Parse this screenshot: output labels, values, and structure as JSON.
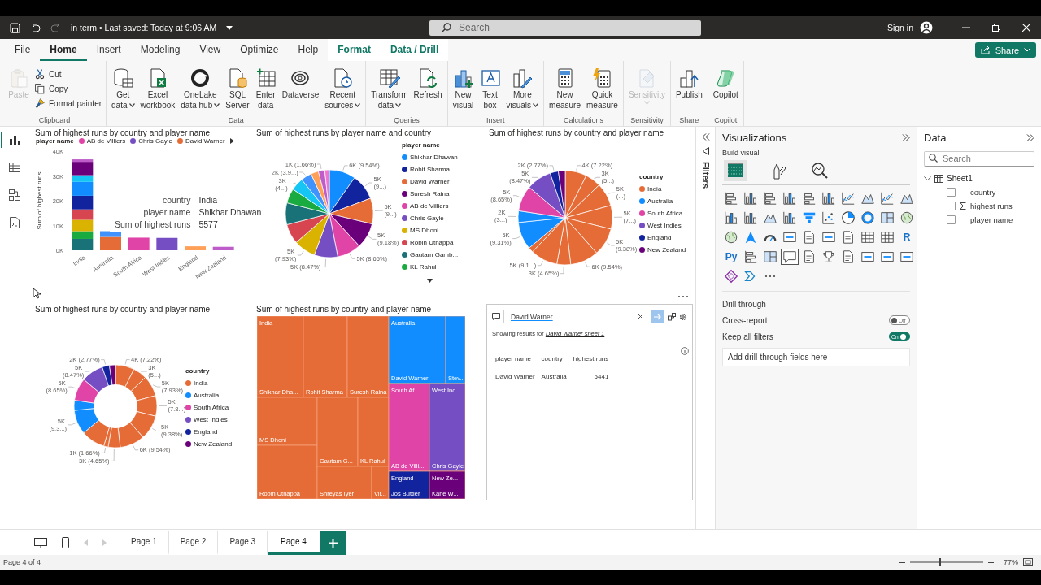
{
  "title_bar": {
    "document": "in term • Last saved: Today at 9:06 AM",
    "search_placeholder": "Search",
    "sign_in": "Sign in"
  },
  "ribbon_tabs": [
    {
      "label": "File",
      "selected": false,
      "kind": "normal"
    },
    {
      "label": "Home",
      "selected": true,
      "kind": "normal"
    },
    {
      "label": "Insert",
      "selected": false,
      "kind": "normal"
    },
    {
      "label": "Modeling",
      "selected": false,
      "kind": "normal"
    },
    {
      "label": "View",
      "selected": false,
      "kind": "normal"
    },
    {
      "label": "Optimize",
      "selected": false,
      "kind": "normal"
    },
    {
      "label": "Help",
      "selected": false,
      "kind": "normal"
    },
    {
      "label": "Format",
      "selected": false,
      "kind": "contextual"
    },
    {
      "label": "Data / Drill",
      "selected": false,
      "kind": "contextual"
    }
  ],
  "share_button": "Share",
  "ribbon_groups": [
    {
      "name": "Clipboard",
      "buttons": [
        {
          "kind": "large",
          "lines": [
            "Paste"
          ],
          "disabled": true,
          "dropdown": false
        },
        {
          "kind": "small",
          "lines": [
            "Cut"
          ],
          "disabled": false,
          "dropdown": false
        },
        {
          "kind": "small",
          "lines": [
            "Copy"
          ],
          "disabled": false,
          "dropdown": false
        },
        {
          "kind": "small",
          "lines": [
            "Format painter"
          ],
          "disabled": false,
          "dropdown": false
        }
      ]
    },
    {
      "name": "Data",
      "buttons": [
        {
          "kind": "large",
          "lines": [
            "Get",
            "data"
          ],
          "disabled": false,
          "dropdown": true
        },
        {
          "kind": "large",
          "lines": [
            "Excel",
            "workbook"
          ],
          "disabled": false,
          "dropdown": false
        },
        {
          "kind": "large",
          "lines": [
            "OneLake",
            "data hub"
          ],
          "disabled": false,
          "dropdown": true
        },
        {
          "kind": "large",
          "lines": [
            "SQL",
            "Server"
          ],
          "disabled": false,
          "dropdown": false
        },
        {
          "kind": "large",
          "lines": [
            "Enter",
            "data"
          ],
          "disabled": false,
          "dropdown": false
        },
        {
          "kind": "large",
          "lines": [
            "Dataverse"
          ],
          "disabled": false,
          "dropdown": false
        },
        {
          "kind": "large",
          "lines": [
            "Recent",
            "sources"
          ],
          "disabled": false,
          "dropdown": true
        }
      ]
    },
    {
      "name": "Queries",
      "buttons": [
        {
          "kind": "large",
          "lines": [
            "Transform",
            "data"
          ],
          "disabled": false,
          "dropdown": true
        },
        {
          "kind": "large",
          "lines": [
            "Refresh"
          ],
          "disabled": false,
          "dropdown": false
        }
      ]
    },
    {
      "name": "Insert",
      "buttons": [
        {
          "kind": "large",
          "lines": [
            "New",
            "visual"
          ],
          "disabled": false,
          "dropdown": false
        },
        {
          "kind": "large",
          "lines": [
            "Text",
            "box"
          ],
          "disabled": false,
          "dropdown": false
        },
        {
          "kind": "large",
          "lines": [
            "More",
            "visuals"
          ],
          "disabled": false,
          "dropdown": true
        }
      ]
    },
    {
      "name": "Calculations",
      "buttons": [
        {
          "kind": "large",
          "lines": [
            "New",
            "measure"
          ],
          "disabled": false,
          "dropdown": false
        },
        {
          "kind": "large",
          "lines": [
            "Quick",
            "measure"
          ],
          "disabled": false,
          "dropdown": false
        }
      ]
    },
    {
      "name": "Sensitivity",
      "buttons": [
        {
          "kind": "large",
          "lines": [
            "Sensitivity"
          ],
          "disabled": true,
          "dropdown": true
        }
      ]
    },
    {
      "name": "Share",
      "buttons": [
        {
          "kind": "large",
          "lines": [
            "Publish"
          ],
          "disabled": false,
          "dropdown": false
        }
      ]
    },
    {
      "name": "Copilot",
      "buttons": [
        {
          "kind": "large",
          "lines": [
            "Copilot"
          ],
          "disabled": false,
          "dropdown": false
        }
      ]
    }
  ],
  "left_rail": [
    {
      "selected": true
    },
    {
      "selected": false
    },
    {
      "selected": false
    },
    {
      "selected": false
    }
  ],
  "visuals": [
    {
      "kind": "bar",
      "title": "Sum of highest runs by country and player name",
      "legend_title": "player name",
      "legend": [
        {
          "label": "AB de Villiers",
          "color": "#e044a7"
        },
        {
          "label": "Chris Gayle",
          "color": "#744ec2"
        },
        {
          "label": "David Warner",
          "color": "#e66c37"
        }
      ],
      "tooltip": [
        {
          "key": "country",
          "value": "India"
        },
        {
          "key": "player name",
          "value": "Shikhar Dhawan"
        },
        {
          "key": "Sum of highest runs",
          "value": "5577"
        }
      ],
      "chart_data": {
        "type": "bar",
        "stacked": true,
        "orientation": "vertical",
        "ylabel": "Sum of highest runs",
        "categories": [
          "India",
          "Australia",
          "South Africa",
          "West Indies",
          "England",
          "New Zealand"
        ],
        "ylim": [
          0,
          40000
        ],
        "yticks": [
          {
            "value": 0,
            "label": "0K"
          },
          {
            "value": 10000,
            "label": "10K"
          },
          {
            "value": 20000,
            "label": "20K"
          },
          {
            "value": 30000,
            "label": "30K"
          },
          {
            "value": 40000,
            "label": "40K"
          }
        ],
        "series": [
          {
            "color": "#197278",
            "values": [
              4600,
              null,
              null,
              null,
              null,
              null
            ]
          },
          {
            "color": "#1aab40",
            "values": [
              3100,
              null,
              null,
              null,
              null,
              null
            ]
          },
          {
            "color": "#d9b300",
            "values": [
              4600,
              null,
              null,
              null,
              null,
              null
            ]
          },
          {
            "color": "#d64550",
            "values": [
              4200,
              null,
              null,
              null,
              null,
              null
            ]
          },
          {
            "color": "#12239e",
            "values": [
              5500,
              null,
              null,
              null,
              null,
              null
            ]
          },
          {
            "color": "#118dff",
            "values": [
              5600,
              null,
              null,
              null,
              null,
              null
            ]
          },
          {
            "color": "#15c6f4",
            "values": [
              2700,
              null,
              null,
              null,
              null,
              null
            ]
          },
          {
            "color": "#6b007b",
            "values": [
              5400,
              null,
              null,
              null,
              null,
              null
            ]
          },
          {
            "color": "#be5dc9",
            "values": [
              1000,
              null,
              null,
              null,
              null,
              null
            ]
          },
          {
            "color": "#e66c37",
            "values": [
              null,
              5400,
              null,
              null,
              null,
              null
            ]
          },
          {
            "color": "#4092ff",
            "values": [
              null,
              2300,
              null,
              null,
              null,
              null
            ]
          },
          {
            "color": "#e044a7",
            "values": [
              null,
              null,
              5100,
              null,
              null,
              null
            ]
          },
          {
            "color": "#744ec2",
            "values": [
              null,
              null,
              null,
              5000,
              null,
              null
            ]
          },
          {
            "color": "#ffa058",
            "values": [
              null,
              null,
              null,
              null,
              1600,
              null
            ]
          },
          {
            "color": "#be5dc9",
            "values": [
              null,
              null,
              null,
              null,
              null,
              1400
            ]
          }
        ]
      }
    },
    {
      "kind": "pie",
      "title": "Sum of highest runs by player name and country",
      "legend_title": "player name",
      "legend_more": true,
      "legend": [
        {
          "label": "Shikhar Dhawan",
          "color": "#118dff"
        },
        {
          "label": "Rohit Sharma",
          "color": "#12239e"
        },
        {
          "label": "David Warner",
          "color": "#e66c37"
        },
        {
          "label": "Suresh Raina",
          "color": "#6b007b"
        },
        {
          "label": "AB de Villiers",
          "color": "#e044a7"
        },
        {
          "label": "Chris Gayle",
          "color": "#744ec2"
        },
        {
          "label": "MS Dhoni",
          "color": "#d9b300"
        },
        {
          "label": "Robin Uthappa",
          "color": "#d64550"
        },
        {
          "label": "Gautam Gamb...",
          "color": "#197278"
        },
        {
          "label": "KL Rahul",
          "color": "#1aab40"
        }
      ],
      "chart_data": {
        "type": "pie",
        "values": [
          5577,
          5484,
          5441,
          5368,
          5057,
          4952,
          4636,
          4221,
          4600,
          3100,
          2718,
          2280,
          1619,
          1350,
          970
        ],
        "colors": [
          "#118dff",
          "#12239e",
          "#e66c37",
          "#6b007b",
          "#e044a7",
          "#744ec2",
          "#d9b300",
          "#d64550",
          "#197278",
          "#1aab40",
          "#15c6f4",
          "#4092ff",
          "#ffa058",
          "#be5dc9",
          "#f472d0"
        ],
        "value_labels": [
          "6K (9.54%)",
          "5K (9...)",
          "5K (9...)",
          "5K (9.18%)",
          "5K (8.65%)",
          "5K (8.47%)",
          "5K (7.93%)",
          null,
          null,
          null,
          "3K (4...)",
          "2K (3.9...)",
          null,
          "1K (1.66%)",
          null
        ]
      }
    },
    {
      "kind": "pie",
      "title": "Sum of highest runs by country and player name",
      "legend_title": "country",
      "legend_more": false,
      "legend": [
        {
          "label": "India",
          "color": "#e66c37"
        },
        {
          "label": "Australia",
          "color": "#118dff"
        },
        {
          "label": "South Africa",
          "color": "#e044a7"
        },
        {
          "label": "West Indies",
          "color": "#744ec2"
        },
        {
          "label": "England",
          "color": "#12239e"
        },
        {
          "label": "New Zealand",
          "color": "#6b007b"
        }
      ],
      "chart_data": {
        "type": "pie",
        "values": [
          4221,
          3100,
          4600,
          4636,
          5484,
          5577,
          2718,
          5368,
          970,
          5441,
          2280,
          5057,
          4952,
          1619,
          1350
        ],
        "colors": [
          "#e66c37",
          "#e66c37",
          "#e66c37",
          "#e66c37",
          "#e66c37",
          "#e66c37",
          "#e66c37",
          "#e66c37",
          "#e66c37",
          "#118dff",
          "#118dff",
          "#e044a7",
          "#744ec2",
          "#12239e",
          "#6b007b"
        ],
        "value_labels": [
          "4K (7.22%)",
          "3K (5...)",
          "5K (...)",
          "5K (7...)",
          "5K (9.38%)",
          "6K (9.54%)",
          "3K (4.65%)",
          "5K (9.1...)",
          null,
          "5K (9.31%)",
          "2K (3...)",
          "5K (8.65%)",
          "5K (8.47%)",
          "2K (2.77%)",
          null
        ]
      }
    },
    {
      "kind": "donut",
      "title": "Sum of highest runs by country and player name",
      "legend_title": "country",
      "legend_more": false,
      "legend": [
        {
          "label": "India",
          "color": "#e66c37"
        },
        {
          "label": "Australia",
          "color": "#118dff"
        },
        {
          "label": "South Africa",
          "color": "#e044a7"
        },
        {
          "label": "West Indies",
          "color": "#744ec2"
        },
        {
          "label": "England",
          "color": "#12239e"
        },
        {
          "label": "New Zealand",
          "color": "#6b007b"
        }
      ],
      "chart_data": {
        "type": "donut",
        "values": [
          4221,
          3100,
          4636,
          4600,
          5484,
          5577,
          2718,
          970,
          5368,
          5441,
          2280,
          5057,
          4952,
          1619,
          1350
        ],
        "colors": [
          "#e66c37",
          "#e66c37",
          "#e66c37",
          "#e66c37",
          "#e66c37",
          "#e66c37",
          "#e66c37",
          "#e66c37",
          "#e66c37",
          "#118dff",
          "#118dff",
          "#e044a7",
          "#744ec2",
          "#12239e",
          "#6b007b"
        ],
        "value_labels": [
          "4K (7.22%)",
          "3K (5...)",
          "5K (7.93%)",
          "5K (7.8...)",
          "5K (9.38%)",
          "6K (9.54%)",
          "3K (4.65%)",
          "1K (1.66%)",
          null,
          "5K (9.3...)",
          null,
          "5K (8.65%)",
          "5K (8.47%)",
          "2K (2.77%)",
          null
        ]
      }
    },
    {
      "kind": "treemap",
      "title": "Sum of highest runs by country and player name",
      "groups": [
        {
          "label": "India",
          "color": "#e66c37",
          "tiles": [
            "Shikhar Dha...",
            "Rohit Sharma",
            "Suresh Raina",
            "MS Dhoni",
            "Robin Uthappa",
            "Gautam G...",
            "KL Rahul",
            "Shreyas Iyer",
            "Vir..."
          ]
        },
        {
          "label": "Australia",
          "color": "#118dff",
          "tiles": [
            "David Warner",
            "Stev..."
          ]
        },
        {
          "label": "South Af...",
          "color": "#e044a7",
          "tiles": [
            "AB de Villi..."
          ]
        },
        {
          "label": "West Ind...",
          "color": "#744ec2",
          "tiles": [
            "Chris Gayle"
          ]
        },
        {
          "label": "England",
          "color": "#12239e",
          "tiles": [
            "Jos Buttler"
          ]
        },
        {
          "label": "New Ze...",
          "color": "#6b007b",
          "tiles": [
            "Kane W..."
          ]
        }
      ]
    },
    {
      "kind": "qna",
      "query": "David Warner",
      "result_prefix": "Showing results for",
      "result_link": "David Warner sheet 1",
      "columns": [
        "player name",
        "country",
        "highest runs"
      ],
      "rows": [
        [
          "David Warner",
          "Australia",
          "5441"
        ]
      ]
    }
  ],
  "filters_label": "Filters",
  "viz_pane": {
    "title": "Visualizations",
    "subtitle": "Build visual",
    "build_tabs": [
      {
        "selected": true
      },
      {
        "selected": false
      },
      {
        "selected": false
      }
    ],
    "gallery": [
      {
        "selected": false
      },
      {
        "selected": false
      },
      {
        "selected": false
      },
      {
        "selected": false
      },
      {
        "selected": false
      },
      {
        "selected": false
      },
      {
        "selected": false
      },
      {
        "selected": false
      },
      {
        "selected": false
      },
      {
        "selected": false
      },
      {
        "selected": false
      },
      {
        "selected": false
      },
      {
        "selected": false
      },
      {
        "selected": false
      },
      {
        "selected": false
      },
      {
        "selected": false
      },
      {
        "selected": false
      },
      {
        "selected": false
      },
      {
        "selected": false
      },
      {
        "selected": false
      },
      {
        "selected": false
      },
      {
        "selected": false
      },
      {
        "selected": false
      },
      {
        "selected": false
      },
      {
        "selected": false
      },
      {
        "selected": false
      },
      {
        "selected": false
      },
      {
        "selected": false
      },
      {
        "selected": false
      },
      {
        "selected": false,
        "label": "R"
      },
      {
        "selected": false,
        "label": "Py"
      },
      {
        "selected": false
      },
      {
        "selected": false
      },
      {
        "selected": true
      },
      {
        "selected": false
      },
      {
        "selected": false
      },
      {
        "selected": false
      },
      {
        "selected": false
      },
      {
        "selected": false
      },
      {
        "selected": false
      },
      {
        "selected": false
      },
      {
        "selected": false
      },
      {
        "selected": false
      }
    ],
    "drill_title": "Drill through",
    "drill_options": [
      {
        "label": "Cross-report",
        "on": false,
        "state_text": "Off"
      },
      {
        "label": "Keep all filters",
        "on": true,
        "state_text": "On"
      }
    ],
    "drop_zone": "Add drill-through fields here"
  },
  "data_pane": {
    "title": "Data",
    "search_placeholder": "Search",
    "tables": [
      {
        "label": "Sheet1",
        "expanded": true,
        "children": [
          {
            "label": "country",
            "kind": "column",
            "checked": false
          },
          {
            "label": "highest runs",
            "kind": "measure",
            "checked": false
          },
          {
            "label": "player name",
            "kind": "column",
            "checked": false
          }
        ]
      }
    ]
  },
  "pages": [
    {
      "label": "Page 1",
      "selected": false
    },
    {
      "label": "Page 2",
      "selected": false
    },
    {
      "label": "Page 3",
      "selected": false
    },
    {
      "label": "Page 4",
      "selected": true
    }
  ],
  "status_bar": {
    "page_info": "Page 4 of 4",
    "zoom": "77%",
    "level": 0.4
  }
}
